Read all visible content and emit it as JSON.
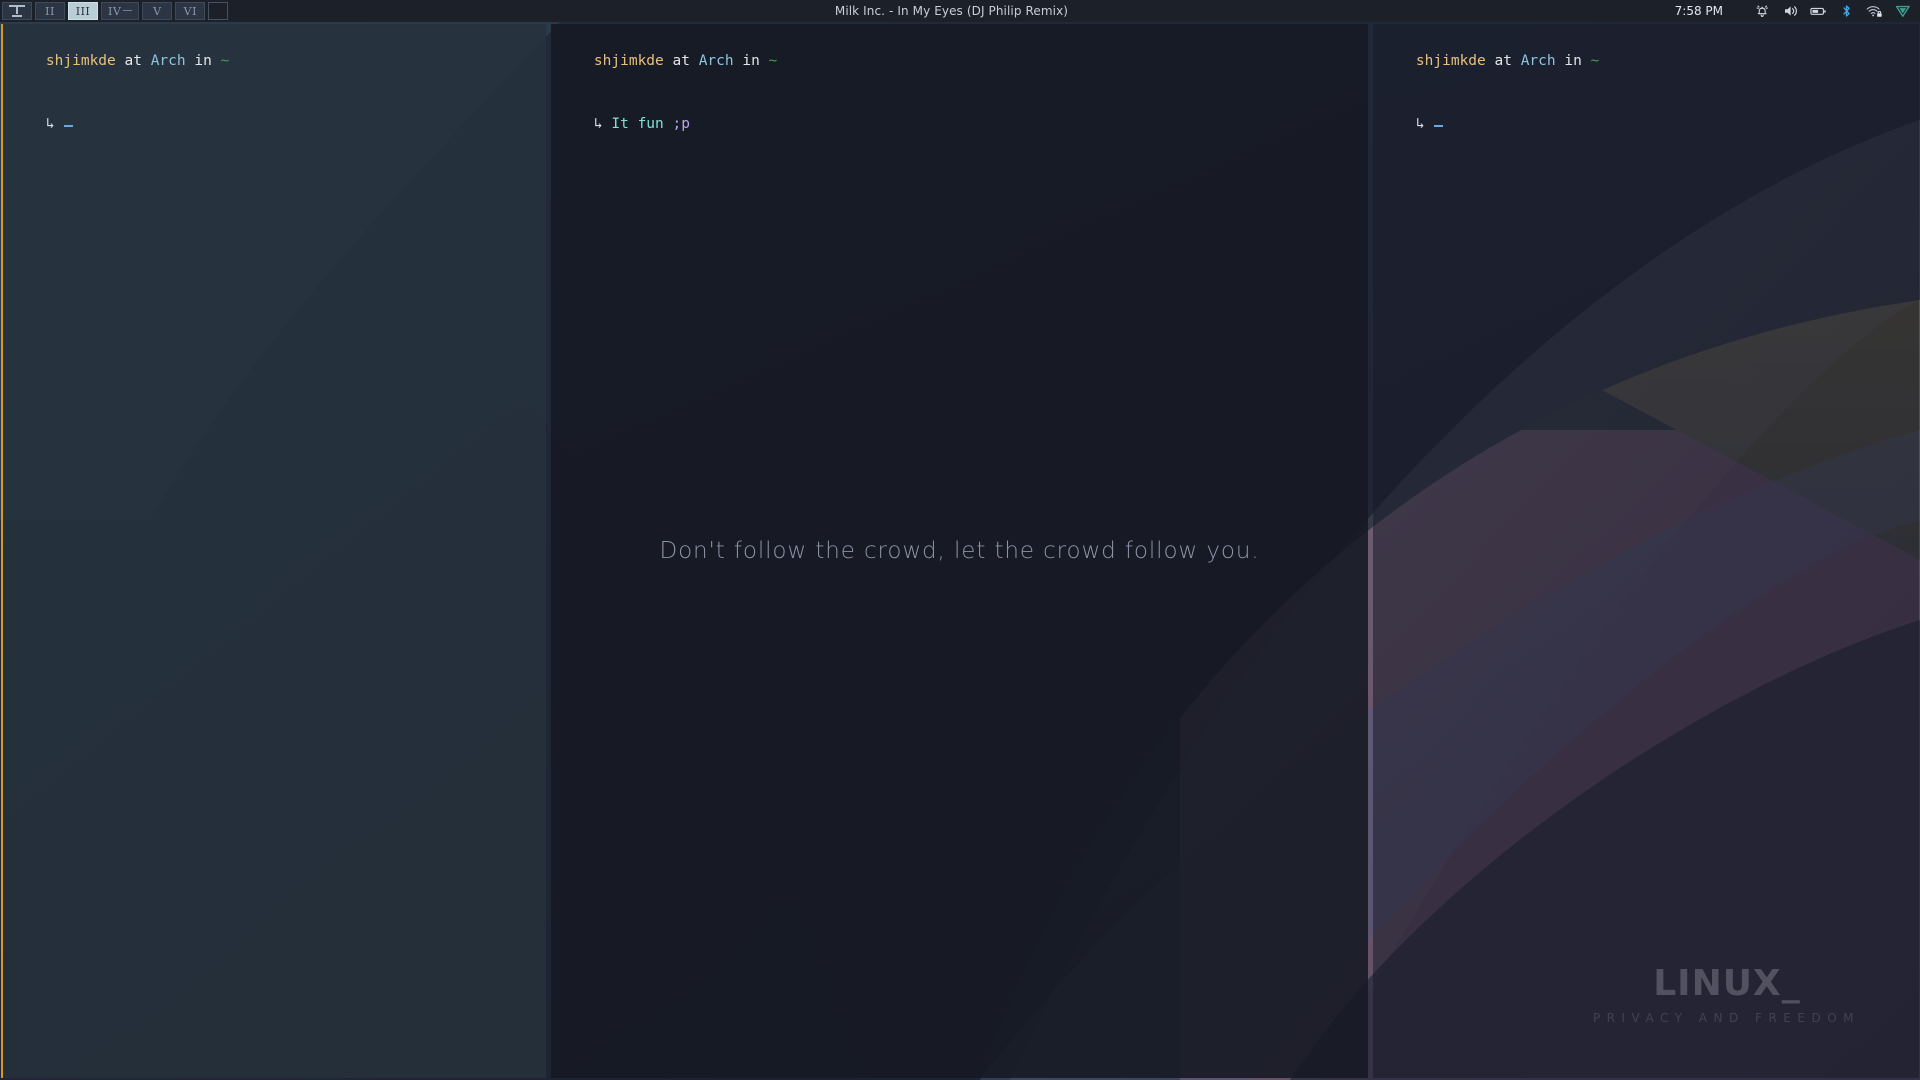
{
  "topbar": {
    "tags": [
      {
        "label": "I",
        "glyph": "layout",
        "selected": false,
        "occupied": true
      },
      {
        "label": "II",
        "glyph": "text",
        "selected": false,
        "occupied": false
      },
      {
        "label": "III",
        "glyph": "text",
        "selected": true,
        "occupied": true
      },
      {
        "label": "IV",
        "glyph": "text",
        "selected": false,
        "occupied": true
      },
      {
        "label": "V",
        "glyph": "text",
        "selected": false,
        "occupied": false
      },
      {
        "label": "VI",
        "glyph": "text",
        "selected": false,
        "occupied": false
      }
    ],
    "layout_indicator": "",
    "window_title": "Milk Inc. - In My Eyes (DJ Philip Remix)",
    "clock": "7:58 PM",
    "tray_icons": [
      "notification-bell-icon",
      "volume-speaker-icon",
      "battery-icon",
      "bluetooth-icon",
      "wifi-locked-icon",
      "vpn-shield-icon"
    ]
  },
  "terminals": {
    "left": {
      "prompt": {
        "user": "shjimkde",
        "at": " at ",
        "host": "Arch",
        "in": " in ",
        "path": "~"
      },
      "continuation": "↳",
      "command": ""
    },
    "middle": {
      "prompt": {
        "user": "shjimkde",
        "at": " at ",
        "host": "Arch",
        "in": " in ",
        "path": "~"
      },
      "continuation": "↳",
      "command_main": "It fun",
      "command_suffix": ";p"
    },
    "right": {
      "prompt": {
        "user": "shjimkde",
        "at": " at ",
        "host": "Arch",
        "in": " in ",
        "path": "~"
      },
      "continuation": "↳",
      "command": ""
    }
  },
  "quote": "Don't follow the crowd, let the crowd follow you.",
  "watermark": {
    "title": "LINUX",
    "underscore": "_",
    "subtitle": "PRIVACY AND FREEDOM"
  },
  "colors": {
    "topbar_bg": "#1b2029",
    "tag_selected_bg": "#b9cdd6",
    "accent_border": "#d79921",
    "prompt_user": "#e8c07a",
    "prompt_host": "#8fc4de",
    "prompt_path": "#3ea14a",
    "command_cyan": "#7fe3d4",
    "command_purple": "#b8a6f0",
    "cursor": "#6fa8dc",
    "quote_text": "#8d93a6"
  }
}
